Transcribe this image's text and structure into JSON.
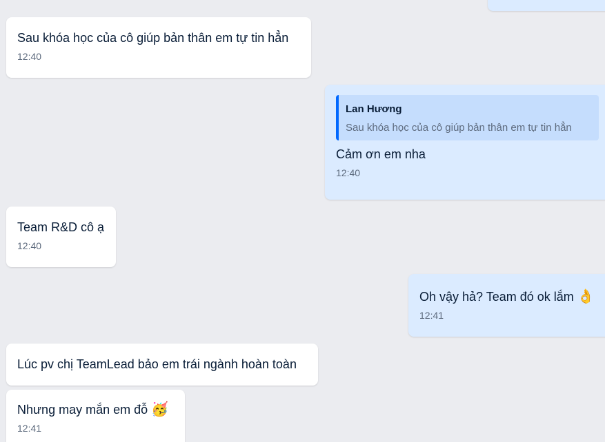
{
  "messages": [
    {
      "id": "m0",
      "direction": "out",
      "text": "",
      "time": ""
    },
    {
      "id": "m1",
      "direction": "in",
      "text": "Sau khóa học của cô giúp bản thân em tự tin hẳn",
      "time": "12:40"
    },
    {
      "id": "m2",
      "direction": "out",
      "quote": {
        "name": "Lan Hương",
        "text": "Sau khóa học của cô giúp bản thân em tự tin hẳn"
      },
      "text": "Cảm ơn em nha",
      "time": "12:40"
    },
    {
      "id": "m3",
      "direction": "in",
      "text": "Team R&D cô ạ",
      "time": "12:40"
    },
    {
      "id": "m4",
      "direction": "out",
      "text": "Oh vậy hả? Team đó ok lắm",
      "emoji": "👌",
      "time": "12:41"
    },
    {
      "id": "m5",
      "direction": "in",
      "text": "Lúc pv chị TeamLead bảo em trái ngành hoàn toàn",
      "time": ""
    },
    {
      "id": "m6",
      "direction": "in",
      "text": "Nhưng may mắn em đỗ",
      "emoji": "🥳",
      "time": "12:41"
    }
  ],
  "colors": {
    "background": "#ebecf0",
    "incoming_bubble": "#ffffff",
    "outgoing_bubble": "#dbebff",
    "quote_background": "#c5ddfd",
    "quote_accent": "#0068ff",
    "time_text": "#5d6a7d"
  }
}
